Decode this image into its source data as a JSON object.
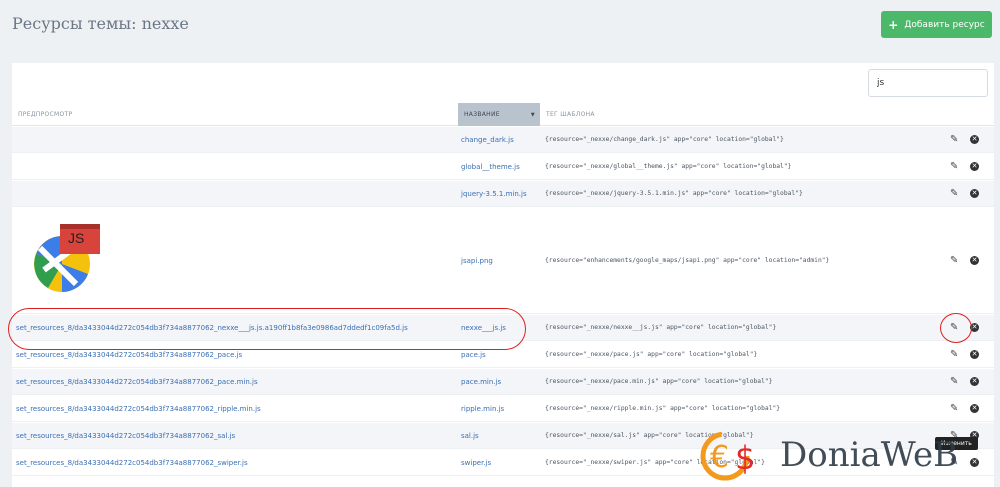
{
  "page": {
    "title": "Ресурсы темы: nexxe"
  },
  "toolbar": {
    "add_label": "Добавить ресурс"
  },
  "search": {
    "value": "js"
  },
  "table": {
    "headers": {
      "preview": "ПРЕДПРОСМОТР",
      "name": "НАЗВАНИЕ",
      "tag": "ТЕГ ШАБЛОНА"
    },
    "rows": [
      {
        "preview": "",
        "name": "change_dark.js",
        "tag": "{resource=\"_nexxe/change_dark.js\" app=\"core\" location=\"global\"}"
      },
      {
        "preview": "",
        "name": "global__theme.js",
        "tag": "{resource=\"_nexxe/global__theme.js\" app=\"core\" location=\"global\"}"
      },
      {
        "preview": "",
        "name": "jquery-3.5.1.min.js",
        "tag": "{resource=\"_nexxe/jquery-3.5.1.min.js\" app=\"core\" location=\"global\"}"
      },
      {
        "preview": "",
        "name": "jsapi.png",
        "tag": "{resource=\"enhancements/google_maps/jsapi.png\" app=\"core\" location=\"admin\"}"
      },
      {
        "preview": "set_resources_8/da3433044d272c054db3f734a8877062_nexxe___js.js.a190ff1b8fa3e0986ad7ddedf1c09fa5d.js",
        "name": "nexxe___js.js",
        "tag": "{resource=\"_nexxe/nexxe__js.js\" app=\"core\" location=\"global\"}"
      },
      {
        "preview": "set_resources_8/da3433044d272c054db3f734a8877062_pace.js",
        "name": "pace.js",
        "tag": "{resource=\"_nexxe/pace.js\" app=\"core\" location=\"global\"}"
      },
      {
        "preview": "set_resources_8/da3433044d272c054db3f734a8877062_pace.min.js",
        "name": "pace.min.js",
        "tag": "{resource=\"_nexxe/pace.min.js\" app=\"core\" location=\"global\"}"
      },
      {
        "preview": "set_resources_8/da3433044d272c054db3f734a8877062_ripple.min.js",
        "name": "ripple.min.js",
        "tag": "{resource=\"_nexxe/ripple.min.js\" app=\"core\" location=\"global\"}"
      },
      {
        "preview": "set_resources_8/da3433044d272c054db3f734a8877062_sal.js",
        "name": "sal.js",
        "tag": "{resource=\"_nexxe/sal.js\" app=\"core\" location=\"global\"}"
      },
      {
        "preview": "set_resources_8/da3433044d272c054db3f734a8877062_swiper.js",
        "name": "swiper.js",
        "tag": "{resource=\"_nexxe/swiper.js\" app=\"core\" location=\"global\"}"
      }
    ]
  },
  "thumb": {
    "badge": "JS"
  },
  "tooltip": {
    "text": "Изменить"
  },
  "watermark": {
    "text": "DoniaWeB"
  },
  "icons": {
    "edit": "pencil-icon",
    "remove": "remove-icon",
    "add": "plus-icon",
    "sort": "sort-desc-icon"
  },
  "colors": {
    "accent": "#4cb96a",
    "link": "#3a6fb5",
    "highlight": "#e02020"
  }
}
